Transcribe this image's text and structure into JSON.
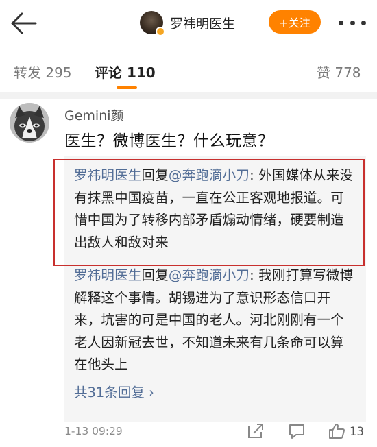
{
  "header": {
    "author_name": "罗祎明医生",
    "follow_label": "+关注"
  },
  "tabs": {
    "forward": "转发 295",
    "comment": "评论 110",
    "like": "赞 778"
  },
  "comment": {
    "username": "Gemini颜",
    "text": "医生？微博医生？什么玩意？",
    "time": "1-13 09:29",
    "like_count": "13"
  },
  "replies": [
    {
      "author": "罗祎明医生",
      "verb": "回复",
      "target": "@奔跑滴小刀",
      "text": ": 外国媒体从来没有抹黑中国疫苗，一直在公正客观地报道。可惜中国为了转移内部矛盾煽动情绪，硬要制造出敌人和敌对来"
    },
    {
      "author": "罗祎明医生",
      "verb": "回复",
      "target": "@奔跑滴小刀",
      "text": ": 我刚打算写微博解释这个事情。胡锡进为了意识形态信口开来，坑害的可是中国的老人。河北刚刚有一个老人因新冠去世，不知道未来有几条命可以算在他头上"
    }
  ],
  "more_replies": "共31条回复 ›",
  "colors": {
    "accent": "#ff8200",
    "link": "#526d96",
    "highlight_border": "#c8302e",
    "reply_bg": "#f5f5f5"
  },
  "icons": [
    "back-arrow-icon",
    "more-dots-icon",
    "verified-badge-icon",
    "share-icon",
    "comment-icon",
    "like-icon"
  ]
}
